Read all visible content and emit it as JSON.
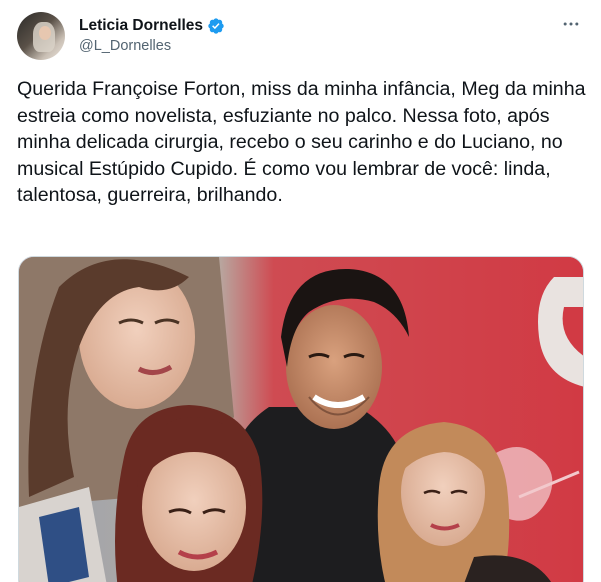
{
  "author": {
    "display_name": "Leticia Dornelles",
    "handle": "@L_Dornelles",
    "verified": true
  },
  "icons": {
    "verified": "verified-badge-icon",
    "more": "more-options-icon"
  },
  "tweet": {
    "text": "Querida Françoise Forton, miss da minha infância, Meg da minha estreia como novelista, esfuziante no palco. Nessa foto, após minha delicada cirurgia, recebo o seu carinho e do Luciano, no musical Estúpido Cupido. É como vou lembrar de você: linda, talentosa, guerreira, brilhando."
  },
  "colors": {
    "verified_blue": "#1d9bf0",
    "backdrop_red": "#c9353f"
  }
}
